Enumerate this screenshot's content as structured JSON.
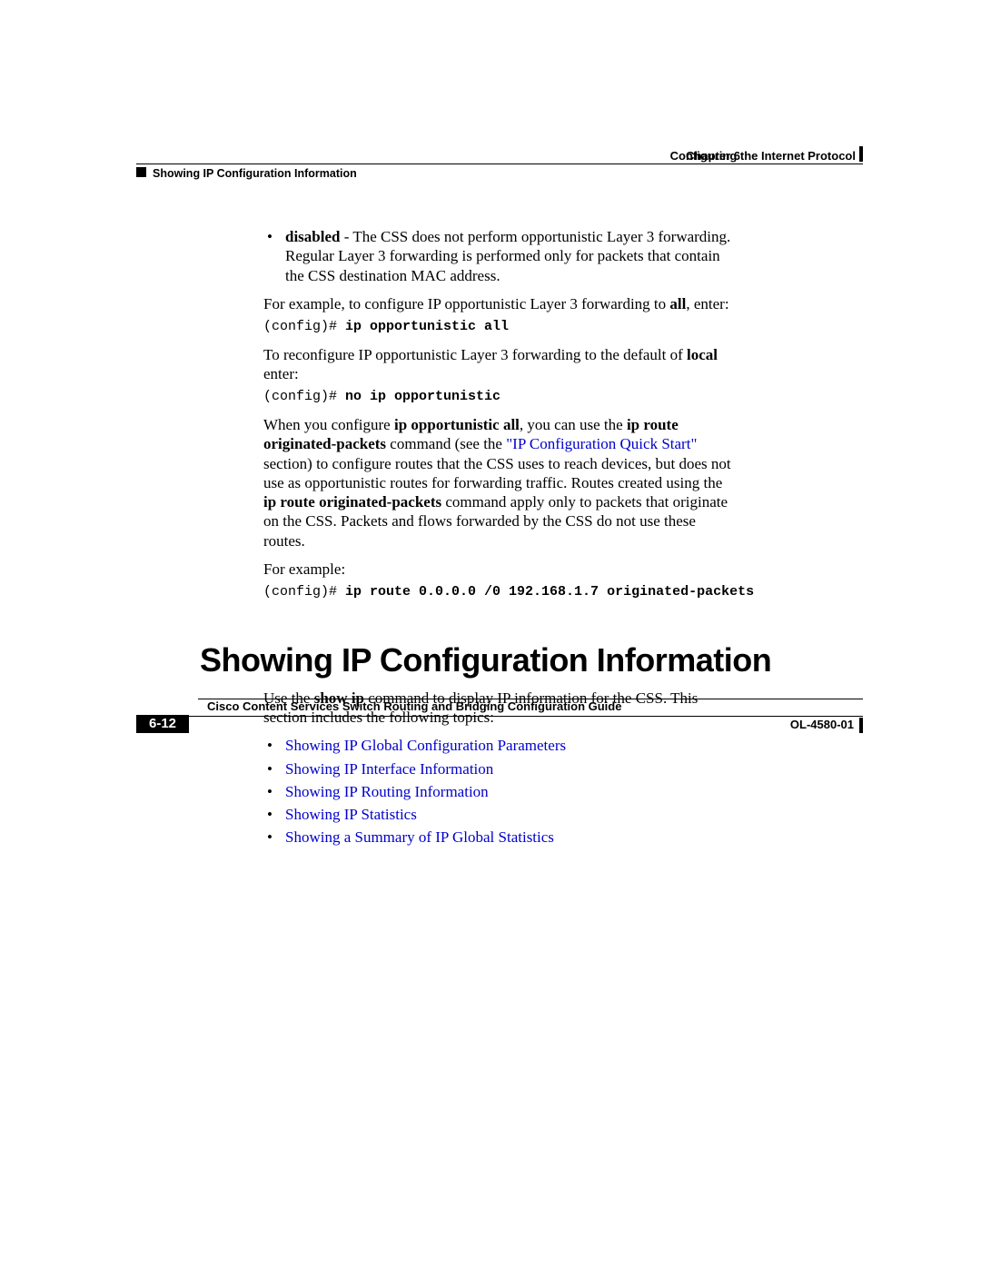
{
  "header": {
    "chapter_label": "Chapter 6",
    "chapter_title": "Configuring the Internet Protocol",
    "section": "Showing IP Configuration Information"
  },
  "bullet_disabled": {
    "term": "disabled",
    "text": " - The CSS does not perform opportunistic Layer 3 forwarding. Regular Layer 3 forwarding is performed only for packets that contain the CSS destination MAC address."
  },
  "para_example_all_pre": "For example, to configure IP opportunistic Layer 3 forwarding to ",
  "para_example_all_bold": "all",
  "para_example_all_post": ", enter:",
  "code1_prefix": "(config)# ",
  "code1_bold": "ip opportunistic all",
  "para_reconfig_pre": "To reconfigure IP opportunistic Layer 3 forwarding to the default of ",
  "para_reconfig_bold": "local",
  "para_reconfig_post": " enter:",
  "code2_prefix": "(config)# ",
  "code2_bold": "no ip opportunistic",
  "para_when": {
    "t1": "When you configure ",
    "b1": "ip opportunistic all",
    "t2": ", you can use the ",
    "b2": "ip route originated-packets",
    "t3": " command (see the ",
    "link": "\"IP Configuration Quick Start\"",
    "t4": " section) to configure routes that the CSS uses to reach devices, but does not use as opportunistic routes for forwarding traffic. Routes created using the ",
    "b3": "ip route originated-packets",
    "t5": " command apply only to packets that originate on the CSS. Packets and flows forwarded by the CSS do not use these routes."
  },
  "para_forexample": "For example:",
  "code3_prefix": "(config)# ",
  "code3_bold": "ip route 0.0.0.0 /0 192.168.1.7 originated-packets",
  "heading": "Showing IP Configuration Information",
  "para_useshowip_pre": "Use the ",
  "para_useshowip_bold": "show ip",
  "para_useshowip_post": " command to display IP information for the CSS. This section includes the following topics:",
  "links": [
    "Showing IP Global Configuration Parameters",
    "Showing IP Interface Information",
    "Showing IP Routing Information",
    "Showing IP Statistics",
    "Showing a Summary of IP Global Statistics"
  ],
  "footer": {
    "guide": "Cisco Content Services Switch Routing and Bridging Configuration Guide",
    "page": "6-12",
    "docnum": "OL-4580-01"
  }
}
